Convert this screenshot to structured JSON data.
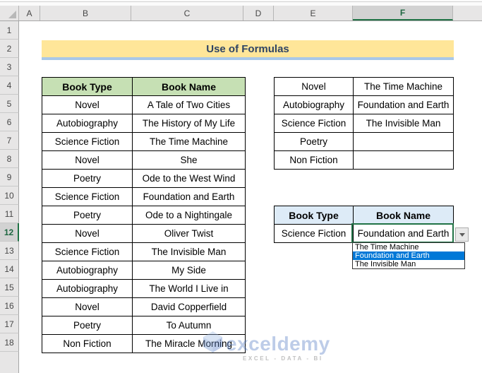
{
  "sheet": {
    "column_cells": [
      {
        "label": "A",
        "selected": false
      },
      {
        "label": "B",
        "selected": false
      },
      {
        "label": "C",
        "selected": false
      },
      {
        "label": "D",
        "selected": false
      },
      {
        "label": "E",
        "selected": false
      },
      {
        "label": "F",
        "selected": true
      }
    ],
    "row_cells": [
      {
        "n": "1"
      },
      {
        "n": "2"
      },
      {
        "n": "3"
      },
      {
        "n": "4"
      },
      {
        "n": "5"
      },
      {
        "n": "6"
      },
      {
        "n": "7"
      },
      {
        "n": "8"
      },
      {
        "n": "9"
      },
      {
        "n": "10"
      },
      {
        "n": "11"
      },
      {
        "n": "12",
        "selected": true
      },
      {
        "n": "13"
      },
      {
        "n": "14"
      },
      {
        "n": "15"
      },
      {
        "n": "16"
      },
      {
        "n": "17"
      },
      {
        "n": "18"
      }
    ],
    "selected_cell_column": "F",
    "selected_cell_row": "12"
  },
  "banner": {
    "title": "Use of Formulas"
  },
  "source_table": {
    "headers": [
      "Book Type",
      "Book Name"
    ],
    "rows": [
      [
        "Novel",
        "A Tale of Two Cities"
      ],
      [
        "Autobiography",
        "The History of My Life"
      ],
      [
        "Science Fiction",
        "The Time Machine"
      ],
      [
        "Novel",
        "She"
      ],
      [
        "Poetry",
        "Ode to the West Wind"
      ],
      [
        "Science Fiction",
        "Foundation and Earth"
      ],
      [
        "Poetry",
        "Ode to a Nightingale"
      ],
      [
        "Novel",
        "Oliver Twist"
      ],
      [
        "Science Fiction",
        "The Invisible Man"
      ],
      [
        "Autobiography",
        "My Side"
      ],
      [
        "Autobiography",
        "The World I Live in"
      ],
      [
        "Novel",
        "David Copperfield"
      ],
      [
        "Poetry",
        "To Autumn"
      ],
      [
        "Non Fiction",
        "The Miracle Morning"
      ]
    ]
  },
  "summary_table": {
    "rows": [
      [
        "Novel",
        "The Time Machine"
      ],
      [
        "Autobiography",
        "Foundation and Earth"
      ],
      [
        "Science Fiction",
        "The Invisible Man"
      ],
      [
        "Poetry",
        ""
      ],
      [
        "Non Fiction",
        ""
      ]
    ]
  },
  "result_table": {
    "headers": [
      "Book Type",
      "Book Name"
    ],
    "row": {
      "book_type": "Science Fiction",
      "book_name": "Foundation and Earth"
    }
  },
  "dropdown": {
    "items": [
      {
        "label": "The Time Machine",
        "selected": false
      },
      {
        "label": "Foundation and Earth",
        "selected": true
      },
      {
        "label": "The Invisible Man",
        "selected": false
      }
    ]
  },
  "watermark": {
    "brand": "exceldemy",
    "tagline": "EXCEL - DATA - BI"
  },
  "icons": {
    "dropdown_arrow": "triangle-down",
    "select_all": "corner-triangle"
  },
  "colors": {
    "banner_bg": "#FFE699",
    "banner_underline": "#A9C8E8",
    "banner_text": "#2E4464",
    "source_header_bg": "#C6E0B4",
    "result_header_bg": "#DDEBF7",
    "selection_green": "#217346",
    "dropdown_highlight": "#0078D7"
  }
}
